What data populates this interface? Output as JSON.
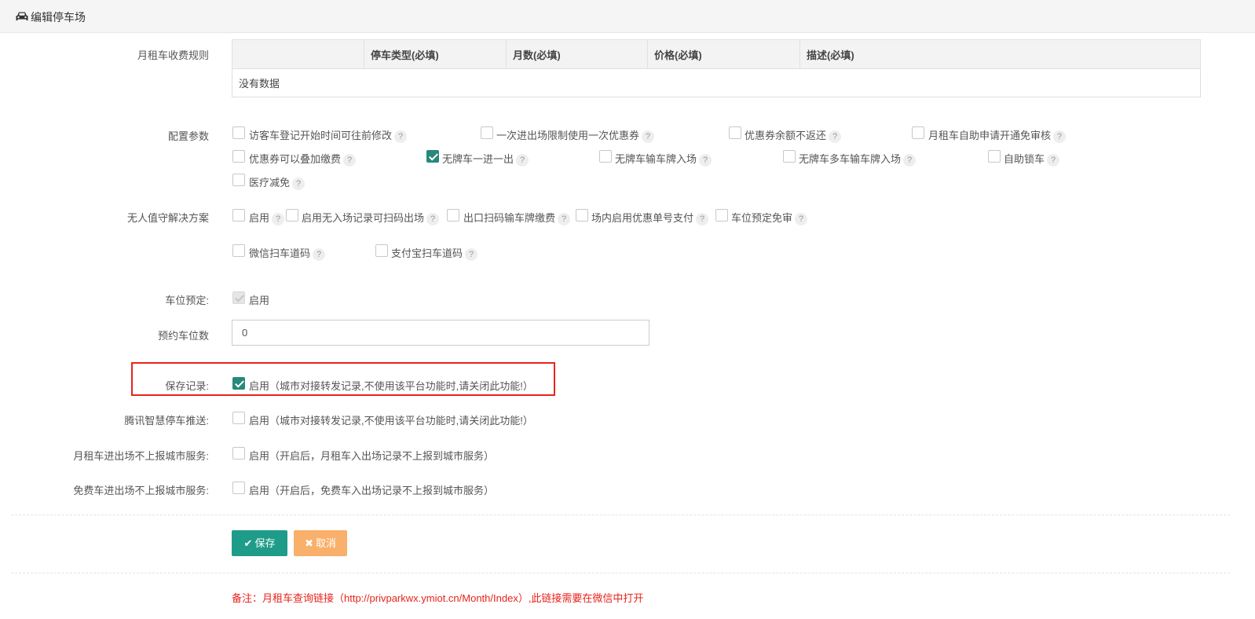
{
  "header": {
    "title": "编辑停车场",
    "icon": "car-icon"
  },
  "monthly_rules": {
    "label": "月租车收费规则",
    "columns": [
      "",
      "停车类型(必填)",
      "月数(必填)",
      "价格(必填)",
      "描述(必填)"
    ],
    "empty_text": "没有数据"
  },
  "config": {
    "label": "配置参数",
    "options": [
      {
        "label": "访客车登记开始时间可往前修改",
        "checked": false
      },
      {
        "label": "一次进出场限制使用一次优惠券",
        "checked": false
      },
      {
        "label": "优惠券余额不返还",
        "checked": false
      },
      {
        "label": "月租车自助申请开通免审核",
        "checked": false
      },
      {
        "label": "优惠券可以叠加缴费",
        "checked": false
      },
      {
        "label": "无牌车一进一出",
        "checked": true
      },
      {
        "label": "无牌车输车牌入场",
        "checked": false
      },
      {
        "label": "无牌车多车输车牌入场",
        "checked": false
      },
      {
        "label": "自助锁车",
        "checked": false
      },
      {
        "label": "医疗减免",
        "checked": false
      }
    ]
  },
  "unattended": {
    "label": "无人值守解决方案",
    "options": [
      {
        "label": "启用",
        "checked": false
      },
      {
        "label": "启用无入场记录可扫码出场",
        "checked": false
      },
      {
        "label": "出口扫码输车牌缴费",
        "checked": false
      },
      {
        "label": "场内启用优惠单号支付",
        "checked": false
      },
      {
        "label": "车位预定免审",
        "checked": false
      },
      {
        "label": "微信扫车道码",
        "checked": false
      },
      {
        "label": "支付宝扫车道码",
        "checked": false
      }
    ]
  },
  "reservation": {
    "label": "车位预定:",
    "option": "启用"
  },
  "reserve_count": {
    "label": "预约车位数",
    "value": "0"
  },
  "save_record": {
    "label": "保存记录:",
    "option": "启用（城市对接转发记录,不使用该平台功能时,请关闭此功能!）"
  },
  "tencent_push": {
    "label": "腾讯智慧停车推送:",
    "option": "启用（城市对接转发记录,不使用该平台功能时,请关闭此功能!）"
  },
  "monthly_no_report": {
    "label": "月租车进出场不上报城市服务:",
    "option": "启用（开启后，月租车入出场记录不上报到城市服务）"
  },
  "free_no_report": {
    "label": "免费车进出场不上报城市服务:",
    "option": "启用（开启后，免费车入出场记录不上报到城市服务）"
  },
  "buttons": {
    "save": "保存",
    "cancel": "取消"
  },
  "note": "备注：月租车查询链接（http://privparkwx.ymiot.cn/Month/Index）,此链接需要在微信中打开",
  "colors": {
    "accent": "#1f9c89",
    "warning": "#f8b06a",
    "danger": "#e8231b"
  }
}
